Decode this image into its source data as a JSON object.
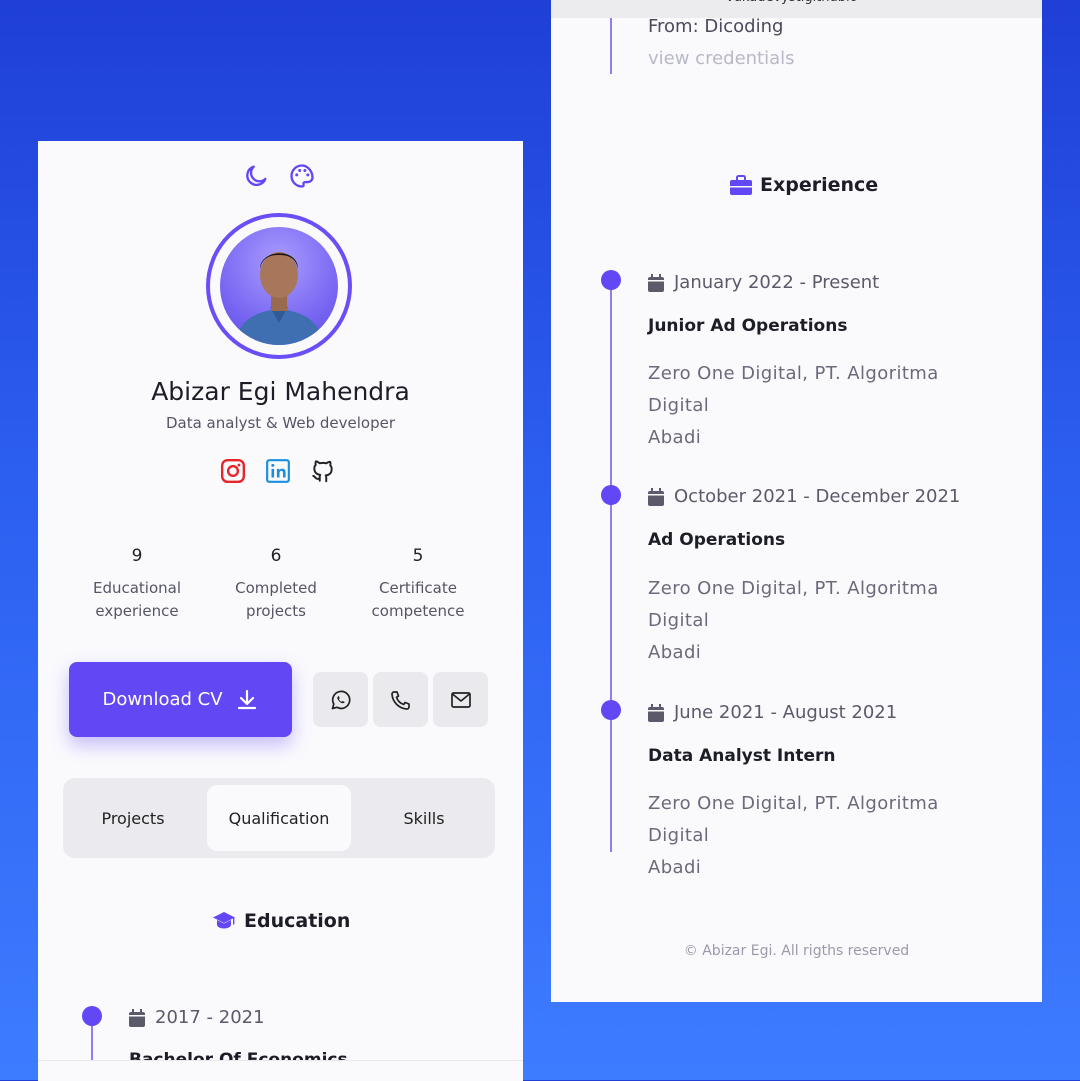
{
  "left": {
    "name": "Abizar Egi Mahendra",
    "role": "Data analyst & Web developer",
    "stats": [
      {
        "value": "9",
        "label_line1": "Educational",
        "label_line2": "experience"
      },
      {
        "value": "6",
        "label_line1": "Completed",
        "label_line2": "projects"
      },
      {
        "value": "5",
        "label_line1": "Certificate",
        "label_line2": "competence"
      }
    ],
    "download_label": "Download CV",
    "tabs": [
      "Projects",
      "Qualification",
      "Skills"
    ],
    "education_title": "Education",
    "education_date": "2017 - 2021",
    "education_degree": "Bachelor Of Economics"
  },
  "right": {
    "top_url": "vukadevystigithublo",
    "from_text": "From: Dicoding",
    "view_credentials": "view credentials",
    "experience_title": "Experience",
    "jobs": [
      {
        "date": "January 2022 - Present",
        "title": "Junior Ad Operations",
        "company_line1": "Zero One Digital, PT. Algoritma Digital",
        "company_line2": "Abadi"
      },
      {
        "date": "October 2021 - December 2021",
        "title": "Ad Operations",
        "company_line1": "Zero One Digital, PT. Algoritma Digital",
        "company_line2": "Abadi"
      },
      {
        "date": "June 2021 - August 2021",
        "title": "Data Analyst Intern",
        "company_line1": "Zero One Digital, PT. Algoritma Digital",
        "company_line2": "Abadi"
      }
    ],
    "footer": "© Abizar Egi. All rigths reserved"
  },
  "colors": {
    "accent": "#6247f5",
    "background_top": "#1f3fd6",
    "background_bottom": "#3d7cff",
    "instagram": "#e4262b",
    "linkedin": "#1a8fe0"
  },
  "icons": [
    "moon-icon",
    "palette-icon",
    "instagram-icon",
    "linkedin-icon",
    "github-icon",
    "download-icon",
    "whatsapp-icon",
    "phone-icon",
    "mail-icon",
    "graduation-cap-icon",
    "briefcase-icon",
    "calendar-icon"
  ]
}
